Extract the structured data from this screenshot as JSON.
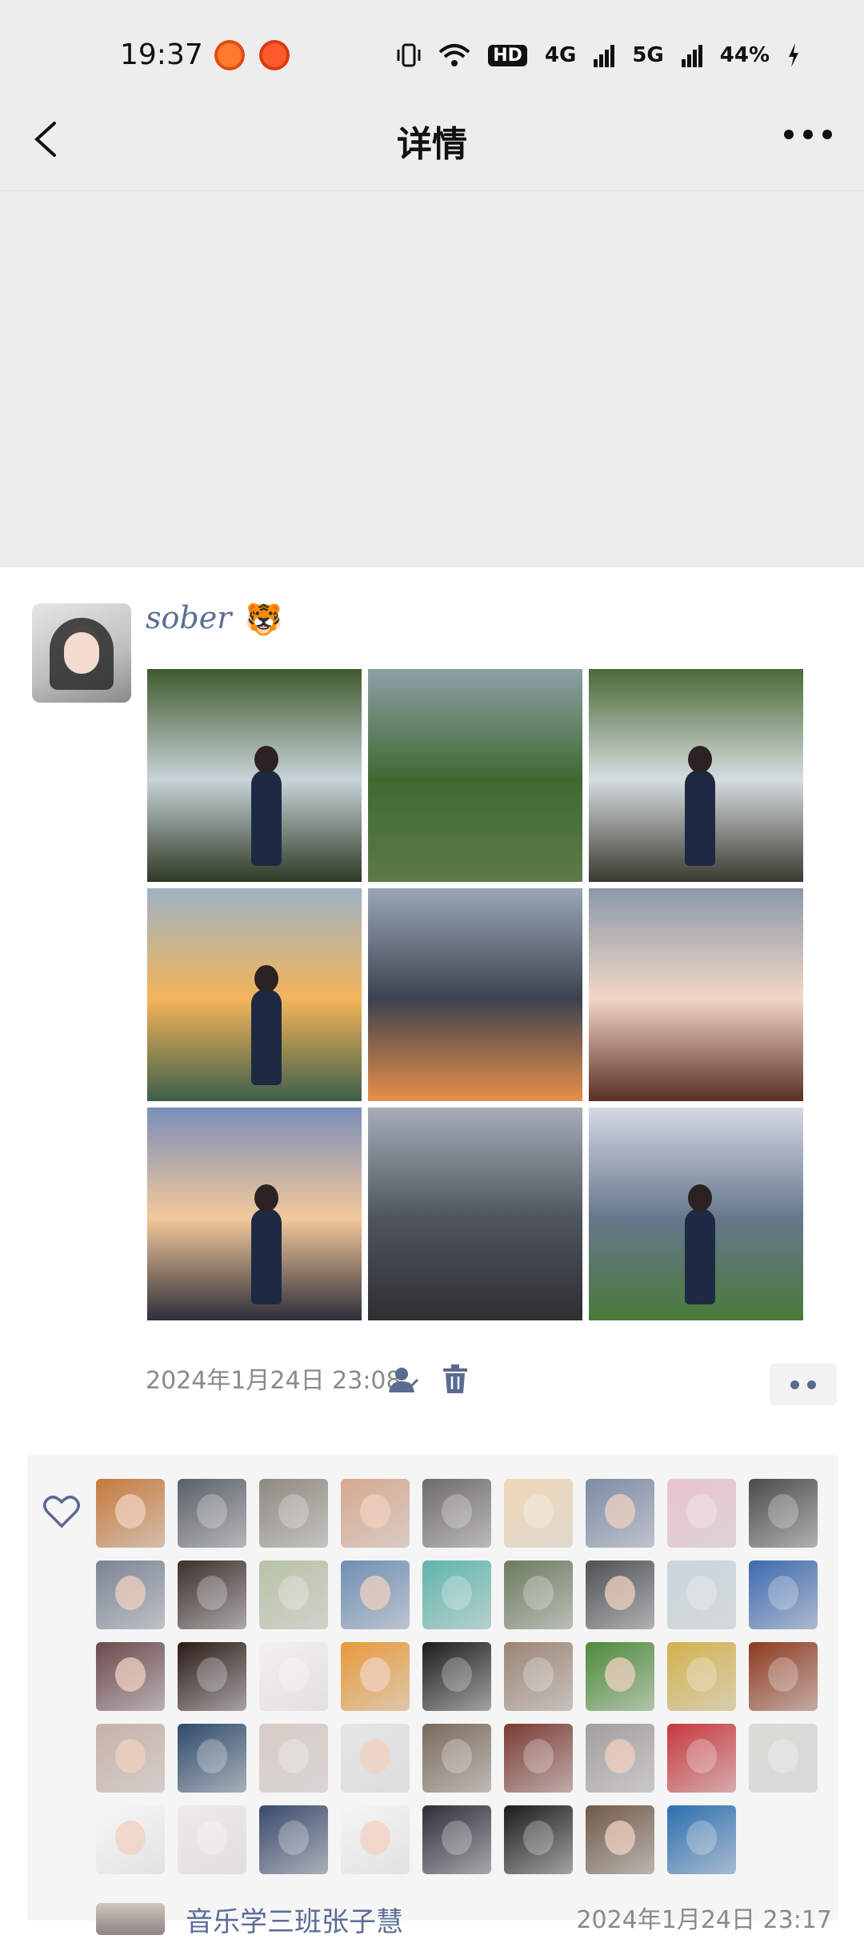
{
  "status_bar": {
    "time": "19:37",
    "right_labels": [
      "HD",
      "4G",
      "5G",
      "44%"
    ]
  },
  "navbar": {
    "title": "详情",
    "back_icon": "chevron-left-icon",
    "more_icon": "more-dots-icon"
  },
  "post": {
    "username": "sober",
    "emoji": "🐯",
    "photos": [
      {
        "name": "waterfall-portrait",
        "colors": [
          "#3f5a2e",
          "#c9d3d8",
          "#2c3a24"
        ]
      },
      {
        "name": "forest-ruins",
        "colors": [
          "#8ea0a6",
          "#3e6a32",
          "#5e7a4a"
        ]
      },
      {
        "name": "waterfall-portrait-2",
        "colors": [
          "#4b6a35",
          "#d6dde0",
          "#3a3a2f"
        ]
      },
      {
        "name": "sea-sunset-girl",
        "colors": [
          "#9fb3c4",
          "#f3b45a",
          "#3d5f49"
        ]
      },
      {
        "name": "ocean-clouds-sunset",
        "colors": [
          "#9aa7b5",
          "#3d4250",
          "#e88f4a"
        ]
      },
      {
        "name": "temple-roof-clouds",
        "colors": [
          "#8c99ab",
          "#f1d6c4",
          "#5a2f24"
        ]
      },
      {
        "name": "temple-gate",
        "colors": [
          "#7b8fb9",
          "#f3c89b",
          "#2d2f3a"
        ]
      },
      {
        "name": "grey-sea-rocks",
        "colors": [
          "#a6aeb9",
          "#4f555e",
          "#2d2f32"
        ]
      },
      {
        "name": "palm-tree-coast",
        "colors": [
          "#d4d8e4",
          "#67778c",
          "#4a7a3a"
        ]
      }
    ],
    "timestamp": "2024年1月24日 23:08",
    "friend_icon": "friend-visibility-icon",
    "delete_icon": "trash-icon"
  },
  "likes": {
    "heart_icon": "heart-outline-icon",
    "avatars": [
      "#c57a3c",
      "#5a6068",
      "#8f8a80",
      "#d6a98f",
      "#6e6a6c",
      "#f0d7b7",
      "#7c8ba6",
      "#e8c3d0",
      "#4b4b4b",
      "#7b8594",
      "#3c2f2c",
      "#b8c2a7",
      "#6f8fb4",
      "#5fb6ac",
      "#6b7b5e",
      "#4e5054",
      "#c9d6dc",
      "#3d6ab0",
      "#6b4a4e",
      "#2a1b17",
      "#f6f0f0",
      "#e89a3a",
      "#1b1b1b",
      "#9b8575",
      "#4e8a3a",
      "#d2b24d",
      "#8e3a1f",
      "#c7b1a8",
      "#2f4a6b",
      "#d8ccc6",
      "#e6e6e6",
      "#7a6a5c",
      "#7b3a33",
      "#a39ea0",
      "#c7383d",
      "#d9dbd4",
      "#f7f7f7",
      "#f0eaea",
      "#3a4a6b",
      "#f5f5f5",
      "#2c2e3a",
      "#1a1a1a",
      "#6f5a48",
      "#2c6fb0"
    ]
  },
  "comment": {
    "name": "音乐学三班张子慧",
    "time": "2024年1月24日 23:17"
  }
}
